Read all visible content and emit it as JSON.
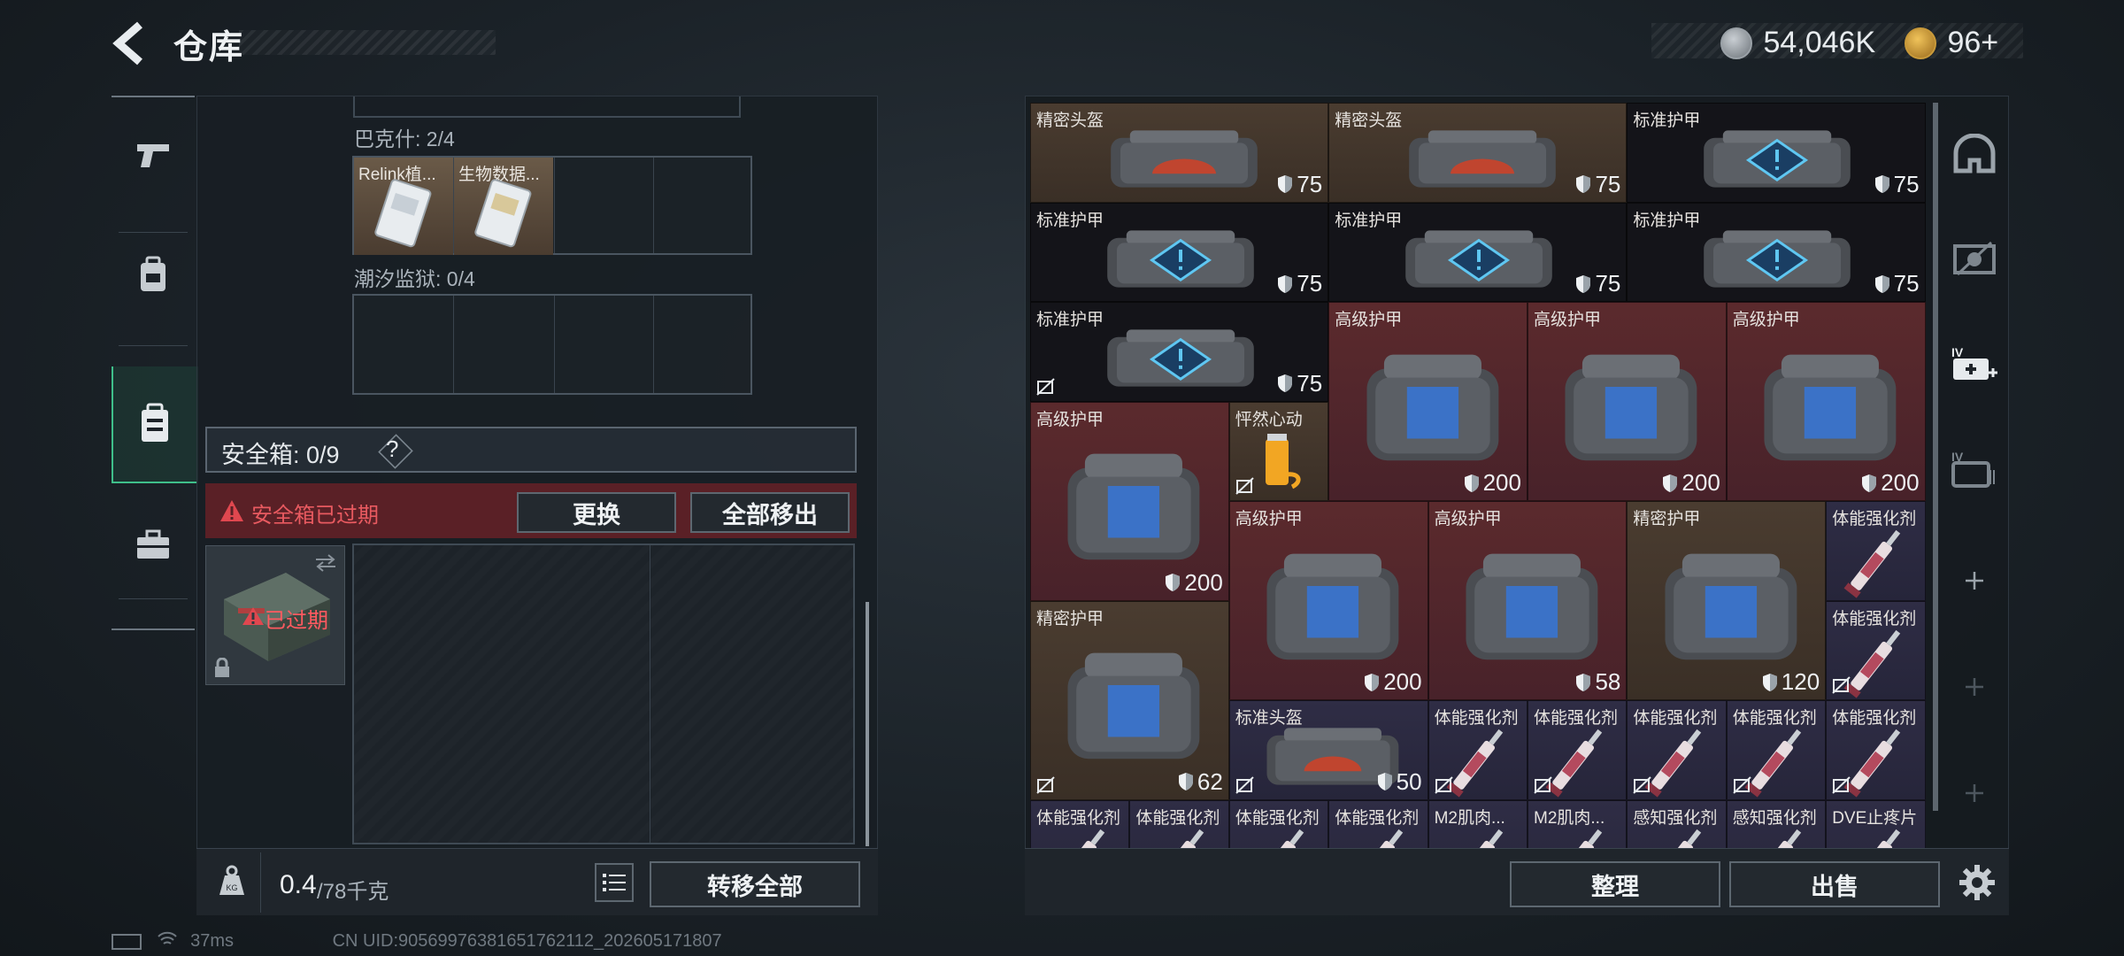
{
  "header": {
    "title": "仓库",
    "currency_1": "54,046K",
    "currency_2": "96+"
  },
  "left": {
    "bakeshi_label": "巴克什: 2/4",
    "bakeshi_items": [
      "Relink植...",
      "生物数据..."
    ],
    "tide_label": "潮汐监狱: 0/4",
    "safebox_label": "安全箱: 0/9",
    "help": "?",
    "expired_warning": "安全箱已过期",
    "replace_btn": "更换",
    "remove_all_btn": "全部移出",
    "case_expired": "已过期",
    "weight_value": "0.4",
    "weight_cap": "/78千克",
    "transfer_all_btn": "转移全部"
  },
  "right": {
    "sort_btn": "整理",
    "sell_btn": "出售"
  },
  "items": [
    {
      "name": "精密头盔",
      "dur": "75",
      "color": "brown",
      "kind": "helmet"
    },
    {
      "name": "精密头盔",
      "dur": "75",
      "color": "brown",
      "kind": "helmet"
    },
    {
      "name": "标准护甲",
      "dur": "75",
      "color": "dark",
      "kind": "warn"
    },
    {
      "name": "标准护甲",
      "dur": "75",
      "color": "dark",
      "kind": "warn"
    },
    {
      "name": "标准护甲",
      "dur": "75",
      "color": "dark",
      "kind": "warn"
    },
    {
      "name": "标准护甲",
      "dur": "75",
      "color": "dark",
      "kind": "warn"
    },
    {
      "name": "标准护甲",
      "dur": "75",
      "color": "dark",
      "kind": "warn"
    },
    {
      "name": "高级护甲",
      "dur": "200",
      "color": "red",
      "kind": "armor"
    },
    {
      "name": "高级护甲",
      "dur": "200",
      "color": "red",
      "kind": "armor"
    },
    {
      "name": "高级护甲",
      "dur": "200",
      "color": "red",
      "kind": "armor"
    },
    {
      "name": "高级护甲",
      "dur": "200",
      "color": "red",
      "kind": "armor"
    },
    {
      "name": "怦然心动",
      "dur": "",
      "color": "brown",
      "kind": "drink"
    },
    {
      "name": "高级护甲",
      "dur": "200",
      "color": "red",
      "kind": "armor"
    },
    {
      "name": "高级护甲",
      "dur": "58",
      "color": "red",
      "kind": "armor"
    },
    {
      "name": "精密护甲",
      "dur": "120",
      "color": "brown",
      "kind": "armor"
    },
    {
      "name": "体能强化剂",
      "dur": "",
      "color": "purple",
      "kind": "syringe"
    },
    {
      "name": "体能强化剂",
      "dur": "",
      "color": "purple",
      "kind": "syringe"
    },
    {
      "name": "精密护甲",
      "dur": "62",
      "color": "brown",
      "kind": "armor"
    },
    {
      "name": "标准头盔",
      "dur": "50",
      "color": "purple",
      "kind": "helmet"
    },
    {
      "name": "体能强化剂",
      "dur": "",
      "color": "purple",
      "kind": "syringe"
    },
    {
      "name": "体能强化剂",
      "dur": "",
      "color": "purple",
      "kind": "syringe"
    },
    {
      "name": "体能强化剂",
      "dur": "",
      "color": "purple",
      "kind": "syringe"
    },
    {
      "name": "体能强化剂",
      "dur": "",
      "color": "purple",
      "kind": "syringe"
    },
    {
      "name": "体能强化剂",
      "dur": "",
      "color": "purple",
      "kind": "syringe"
    },
    {
      "name": "体能强化剂",
      "dur": "",
      "color": "purple",
      "kind": "syringe"
    },
    {
      "name": "体能强化剂",
      "dur": "",
      "color": "purple",
      "kind": "syringe"
    },
    {
      "name": "体能强化剂",
      "dur": "",
      "color": "purple",
      "kind": "syringe"
    },
    {
      "name": "体能强化剂",
      "dur": "",
      "color": "purple",
      "kind": "syringe"
    },
    {
      "name": "M2肌肉...",
      "dur": "",
      "color": "purple",
      "kind": "syringe"
    },
    {
      "name": "M2肌肉...",
      "dur": "",
      "color": "purple",
      "kind": "syringe"
    },
    {
      "name": "感知强化剂",
      "dur": "",
      "color": "purple",
      "kind": "syringe"
    },
    {
      "name": "感知强化剂",
      "dur": "",
      "color": "purple",
      "kind": "syringe"
    },
    {
      "name": "DVE止疼片",
      "dur": "",
      "color": "purple",
      "kind": "syringe"
    }
  ],
  "status": {
    "ping": "37ms",
    "uid": "CN UID:9056997638165176211​2_202605171807"
  },
  "colors": {
    "accent_green": "#3fbf8a",
    "warn_red": "#e0474f",
    "item_brown": "#4a3c30",
    "item_red": "#5b2a2d",
    "item_purple": "#2f2d45"
  }
}
